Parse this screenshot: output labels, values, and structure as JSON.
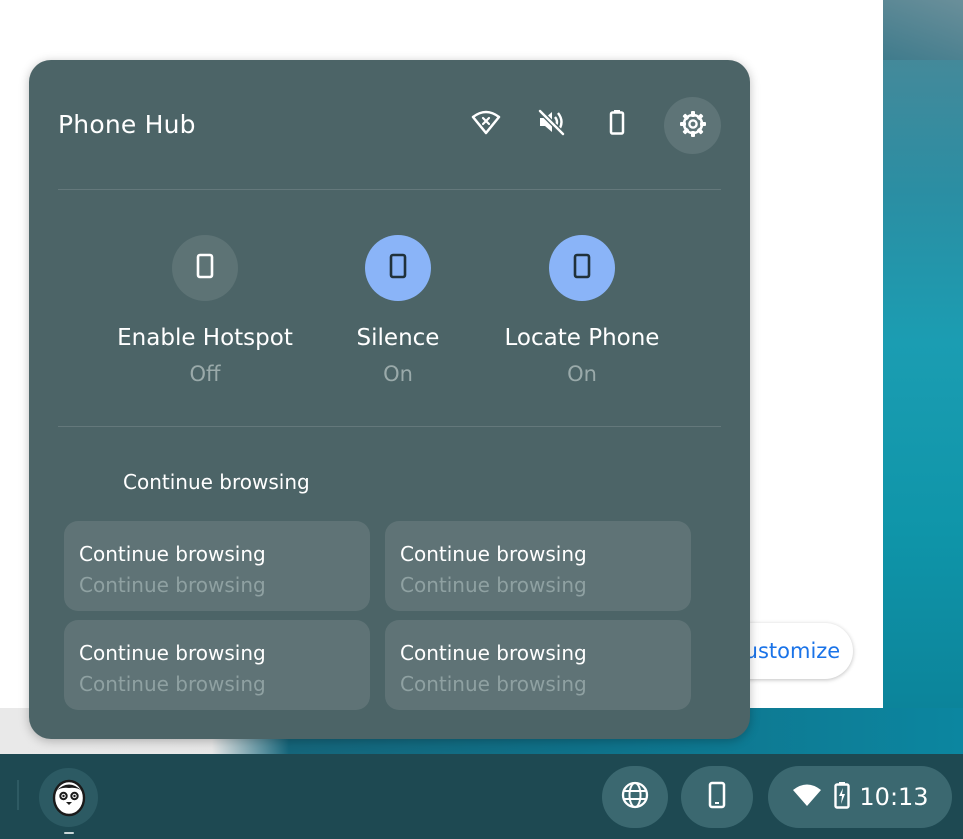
{
  "phone_hub": {
    "title": "Phone Hub",
    "status_icons": [
      "wifi-off-icon",
      "volume-mute-icon",
      "phone-battery-icon"
    ],
    "settings_icon": "gear-icon",
    "quick_actions": [
      {
        "label": "Enable Hotspot",
        "state": "Off",
        "active": false,
        "icon": "phone-icon"
      },
      {
        "label": "Silence",
        "state": "On",
        "active": true,
        "icon": "phone-icon"
      },
      {
        "label": "Locate Phone",
        "state": "On",
        "active": true,
        "icon": "phone-icon"
      }
    ],
    "continue_browsing": {
      "title": "Continue browsing",
      "chips": [
        {
          "title": "Continue browsing",
          "subtitle": "Continue browsing"
        },
        {
          "title": "Continue browsing",
          "subtitle": "Continue browsing"
        },
        {
          "title": "Continue browsing",
          "subtitle": "Continue browsing"
        },
        {
          "title": "Continue browsing",
          "subtitle": "Continue browsing"
        }
      ]
    }
  },
  "background": {
    "customize_label": "Customize"
  },
  "shelf": {
    "launcher_icon": "penguin-avatar-icon",
    "globe_icon": "globe-icon",
    "phone_icon": "phone-icon",
    "tray": {
      "wifi_icon": "wifi-icon",
      "battery_icon": "battery-charging-icon",
      "time": "10:13"
    }
  },
  "colors": {
    "hub_background": "#4c6467",
    "active_toggle": "#8ab4f8",
    "shelf": "#1e4952",
    "accent_link": "#1a73e8"
  }
}
